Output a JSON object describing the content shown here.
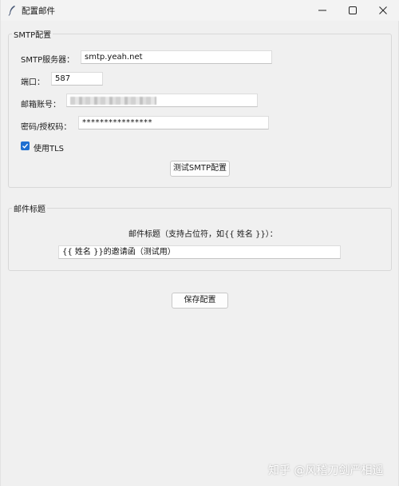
{
  "window": {
    "title": "配置邮件",
    "controls": {
      "minimize": "minimize",
      "maximize": "maximize",
      "close": "close"
    }
  },
  "smtp_group": {
    "title": "SMTP配置",
    "server_label": "SMTP服务器：",
    "server_value": "smtp.yeah.net",
    "port_label": "端口：",
    "port_value": "587",
    "account_label": "邮箱账号：",
    "account_value": "",
    "password_label": "密码/授权码：",
    "password_value": "****************",
    "tls_label": "使用TLS",
    "tls_checked": true,
    "test_button": "测试SMTP配置"
  },
  "subject_group": {
    "title": "邮件标题",
    "hint": "邮件标题（支持占位符，如{{ 姓名 }}）：",
    "subject_value": "{{ 姓名 }}的邀请函（测试用）"
  },
  "save_button": "保存配置",
  "watermark": "知乎 @风稽刀剑严相遥",
  "colors": {
    "accent": "#1f6fd1",
    "window_bg": "#f0f0f0",
    "field_bg": "#ffffff"
  }
}
